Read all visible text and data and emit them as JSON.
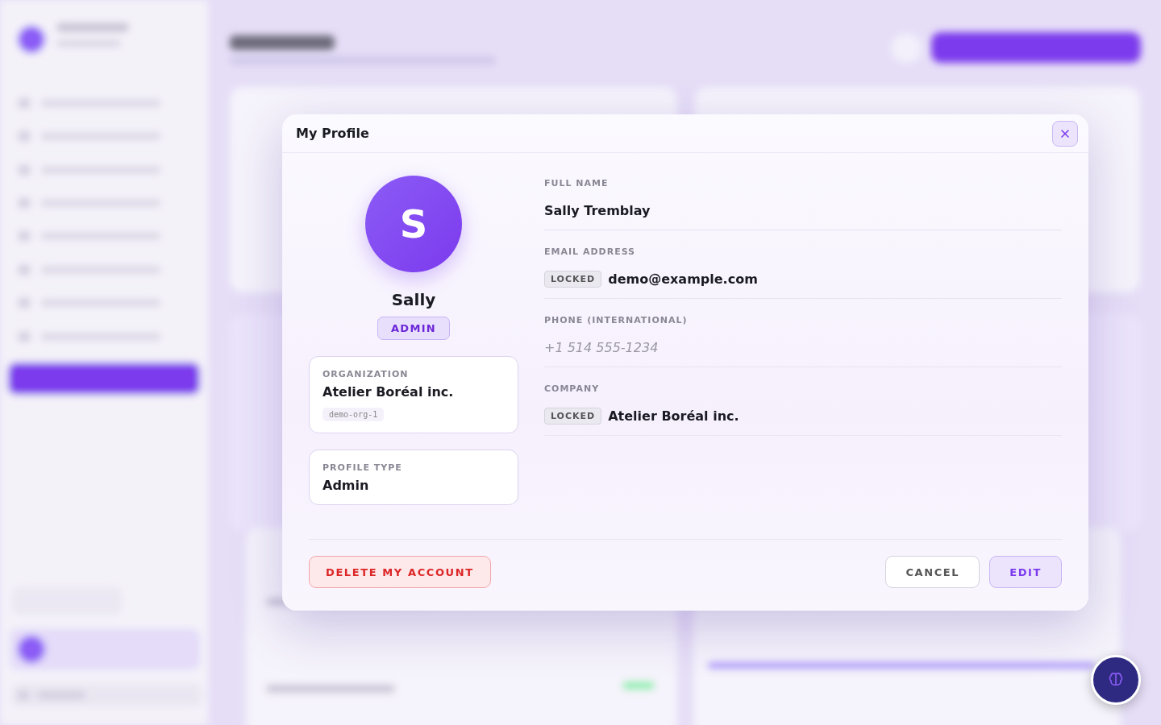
{
  "dialog": {
    "title": "My Profile",
    "avatar": {
      "initial": "S",
      "name": "Sally",
      "role_badge": "ADMIN"
    },
    "cards": [
      {
        "label": "ORGANIZATION",
        "value": "Atelier Boréal inc.",
        "code": "demo-org-1"
      },
      {
        "label": "PROFILE TYPE",
        "value": "Admin"
      }
    ],
    "fields": [
      {
        "label": "FULL NAME",
        "kind": "text",
        "value": "Sally Tremblay"
      },
      {
        "label": "EMAIL ADDRESS",
        "kind": "locked",
        "badge": "LOCKED",
        "value": "demo@example.com"
      },
      {
        "label": "PHONE (INTERNATIONAL)",
        "kind": "placeholder",
        "placeholder": "+1 514 555-1234"
      },
      {
        "label": "COMPANY",
        "kind": "locked",
        "badge": "LOCKED",
        "value": "Atelier Boréal inc."
      }
    ],
    "delete_button": "DELETE MY ACCOUNT",
    "buttons": [
      "CANCEL",
      "EDIT"
    ]
  }
}
